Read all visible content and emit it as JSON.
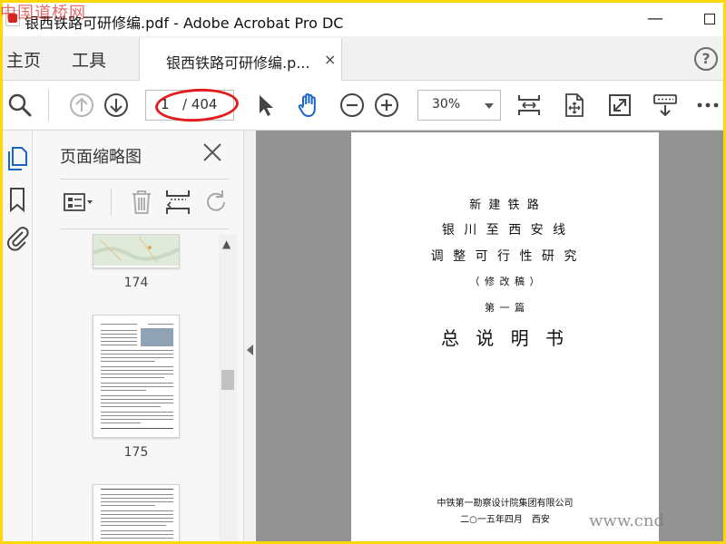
{
  "watermark": {
    "top_left": "中国道桥网",
    "bottom_right": "www.cnd"
  },
  "window": {
    "title": "银西铁路可研修编.pdf - Adobe Acrobat Pro DC",
    "minimize_symbol": "—"
  },
  "menu": {
    "home": "主页",
    "tools": "工具",
    "doc_tab": "银西铁路可研修编.p...",
    "tab_close": "×",
    "help": "?"
  },
  "toolbar": {
    "page_current": "1",
    "page_total": "/ 404",
    "zoom": "30%",
    "highlight_color": "#e01e1e"
  },
  "thumbnails_panel": {
    "title": "页面缩略图",
    "pages": [
      {
        "label": "174"
      },
      {
        "label": "175"
      }
    ]
  },
  "document": {
    "lines": [
      "新 建 铁 路",
      "银 川 至 西 安 线",
      "调 整 可 行 性 研 究",
      "（ 修 改 稿 ）",
      "第 一 篇",
      "总 说 明 书",
      "中铁第一勘察设计院集团有限公司",
      "二○一五年四月　西安"
    ]
  },
  "icons": [
    "search-icon",
    "prev-page-icon",
    "next-page-icon",
    "select-arrow-icon",
    "hand-tool-icon",
    "zoom-out-icon",
    "zoom-in-icon",
    "fit-page-icon",
    "scroll-mode-icon",
    "full-screen-icon",
    "read-mode-icon",
    "more-icon",
    "pages-icon",
    "bookmark-icon",
    "attachment-icon",
    "thumbnail-options-icon",
    "delete-icon",
    "extract-icon",
    "rotate-icon",
    "close-icon"
  ]
}
